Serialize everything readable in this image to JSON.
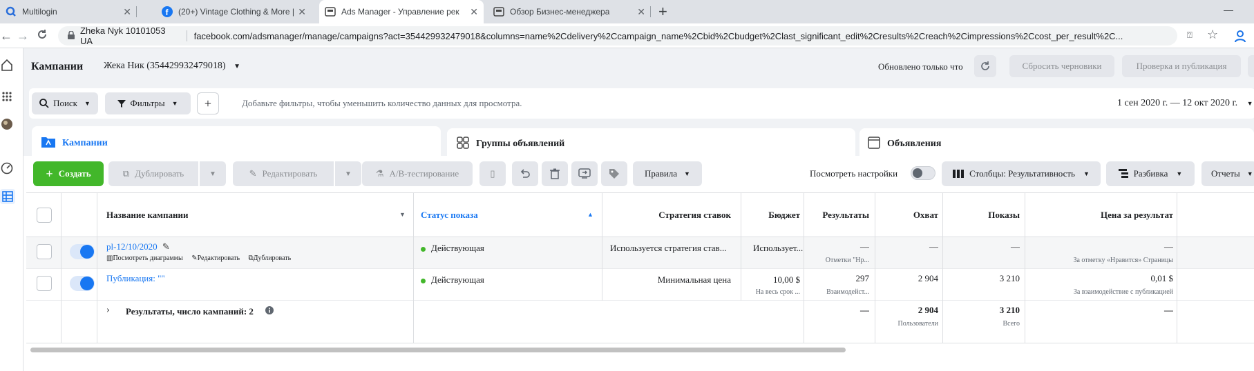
{
  "browser": {
    "tabs": [
      {
        "title": "Multilogin",
        "icon": "multilogin-icon"
      },
      {
        "title": "(20+) Vintage Clothing & More |",
        "icon": "facebook-icon"
      },
      {
        "title": "Ads Manager - Управление рек",
        "icon": "ads-manager-icon"
      },
      {
        "title": "Обзор Бизнес-менеджера",
        "icon": "business-manager-icon"
      }
    ],
    "new_tab": "+",
    "minimize": "—",
    "profile": "Zheka Nyk 10101053 UA",
    "url": "facebook.com/adsmanager/manage/campaigns?act=354429932479018&columns=name%2Cdelivery%2Ccampaign_name%2Cbid%2Cbudget%2Clast_significant_edit%2Cresults%2Creach%2Cimpressions%2Ccost_per_result%2C..."
  },
  "header": {
    "title": "Кампании",
    "account": "Жека Ник (354429932479018)",
    "updated": "Обновлено только что",
    "discard": "Сбросить черновики",
    "review": "Проверка и публикация"
  },
  "filter": {
    "search": "Поиск",
    "filters": "Фильтры",
    "add": "+",
    "placeholder": "Добавьте фильтры, чтобы уменьшить количество данных для просмотра.",
    "date_range": "1 сен 2020 г. — 12 окт 2020 г."
  },
  "levels": {
    "campaigns": "Кампании",
    "adsets": "Группы объявлений",
    "ads": "Объявления"
  },
  "toolbar": {
    "create": "Создать",
    "duplicate": "Дублировать",
    "edit": "Редактировать",
    "ab_test": "A/B-тестирование",
    "rules": "Правила",
    "view_settings": "Посмотреть настройки",
    "columns": "Столбцы: Результативность",
    "breakdown": "Разбивка",
    "reports": "Отчеты"
  },
  "table": {
    "headers": {
      "name": "Название кампании",
      "delivery": "Статус показа",
      "bid": "Стратегия ставок",
      "budget": "Бюджет",
      "results": "Результаты",
      "reach": "Охват",
      "impressions": "Показы",
      "cost": "Цена за результат"
    },
    "rows": [
      {
        "name": "pl-12/10/2020",
        "actions": {
          "charts": "Посмотреть диаграммы",
          "edit": "Редактировать",
          "duplicate": "Дублировать"
        },
        "delivery": "Действующая",
        "bid": "Используется стратегия став...",
        "budget": "Использует...",
        "results": "—",
        "results_sub": "Отметки \"Нр...",
        "reach": "—",
        "impressions": "—",
        "cost": "—",
        "cost_sub": "За отметку «Нравится» Страницы"
      },
      {
        "name": "Публикация: \"\"",
        "delivery": "Действующая",
        "bid": "Минимальная цена",
        "budget": "10,00 $",
        "budget_sub": "На весь срок ...",
        "results": "297",
        "results_sub": "Взаимодейст...",
        "reach": "2 904",
        "impressions": "3 210",
        "cost": "0,01 $",
        "cost_sub": "За взаимодействие с публикацией"
      }
    ],
    "summary": {
      "label": "Результаты, число кампаний: 2",
      "results": "—",
      "reach": "2 904",
      "reach_sub": "Пользователи",
      "impressions": "3 210",
      "impressions_sub": "Всего",
      "cost": "—"
    }
  },
  "colors": {
    "accent": "#1877f2",
    "create": "#42b72a",
    "status": "#42b72a"
  }
}
